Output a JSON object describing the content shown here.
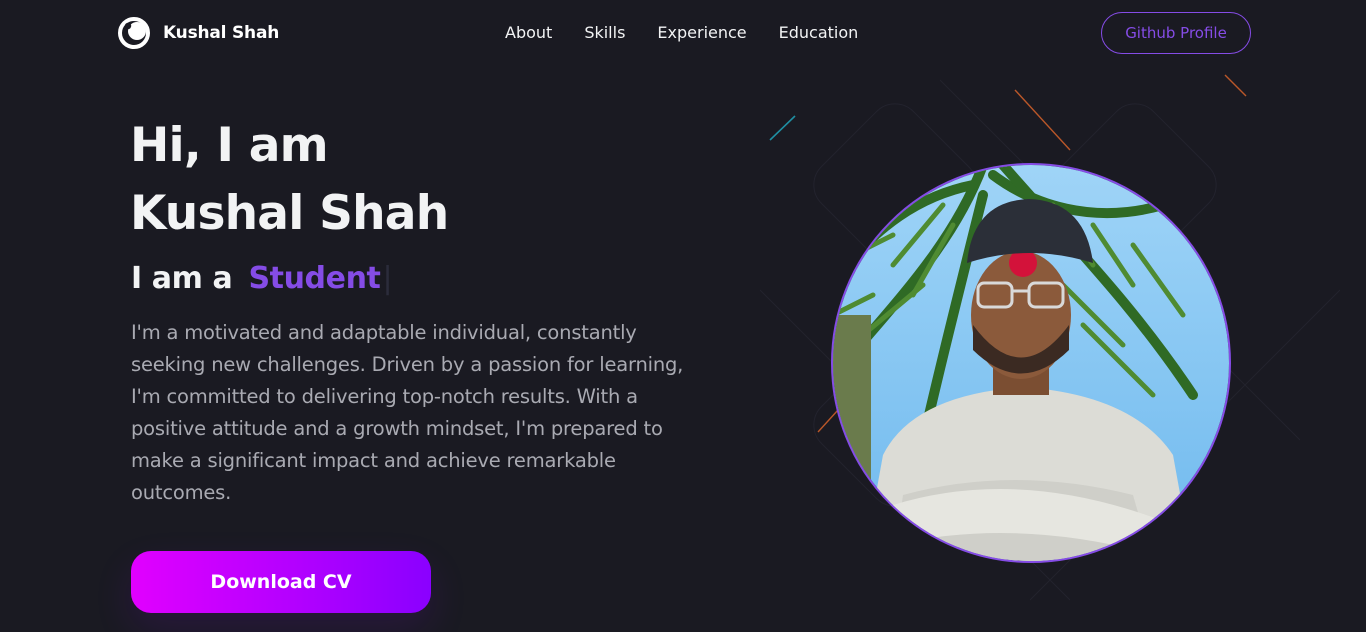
{
  "nav": {
    "logo_text": "Kushal Shah",
    "links": [
      "About",
      "Skills",
      "Experience",
      "Education"
    ],
    "github_label": "Github Profile"
  },
  "hero": {
    "title_line1": "Hi, I am",
    "title_line2": "Kushal Shah",
    "typing_prefix": "I am a",
    "typing_role": "Student",
    "typing_cursor": "|",
    "bio": "I'm a motivated and adaptable individual, constantly seeking new challenges. Driven by a passion for learning, I'm committed to delivering top-notch results. With a positive attitude and a growth mindset, I'm prepared to make a significant impact and achieve remarkable outcomes.",
    "cv_label": "Download CV"
  },
  "colors": {
    "background": "#1a1a22",
    "accent": "#854ce6",
    "text_primary": "#f2f3f4",
    "text_secondary": "#a9aab2",
    "button_gradient_start": "#e100ff",
    "button_gradient_end": "#8a00ff"
  },
  "icons": {
    "logo": "logo-ring-icon"
  }
}
